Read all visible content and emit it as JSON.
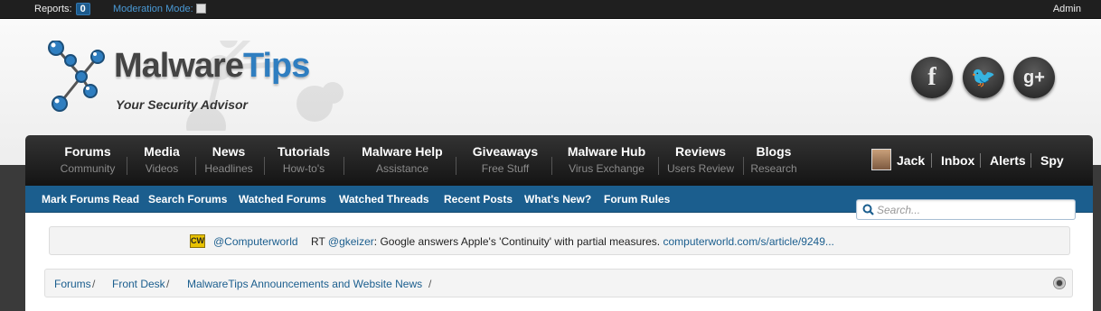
{
  "adminbar": {
    "reports_label": "Reports:",
    "reports_count": "0",
    "moderation_label": "Moderation Mode:",
    "admin_label": "Admin"
  },
  "logo": {
    "word_main": "Malware",
    "word_accent": "Tips",
    "tagline": "Your Security Advisor"
  },
  "social": {
    "facebook": "f",
    "twitter": "🐦",
    "googleplus": "g+"
  },
  "nav": {
    "tabs": [
      {
        "title": "Forums",
        "sub": "Community"
      },
      {
        "title": "Media",
        "sub": "Videos"
      },
      {
        "title": "News",
        "sub": "Headlines"
      },
      {
        "title": "Tutorials",
        "sub": "How-to's"
      },
      {
        "title": "Malware Help",
        "sub": "Assistance"
      },
      {
        "title": "Giveaways",
        "sub": "Free Stuff"
      },
      {
        "title": "Malware Hub",
        "sub": "Virus Exchange"
      },
      {
        "title": "Reviews",
        "sub": "Users Review"
      },
      {
        "title": "Blogs",
        "sub": "Research"
      }
    ],
    "user": "Jack",
    "inbox": "Inbox",
    "alerts": "Alerts",
    "spy": "Spy"
  },
  "subnav": {
    "items": [
      "Mark Forums Read",
      "Search Forums",
      "Watched Forums",
      "Watched Threads",
      "Recent Posts",
      "What's New?",
      "Forum Rules"
    ]
  },
  "search": {
    "placeholder": "Search..."
  },
  "ticker": {
    "badge": "CW",
    "handle": "@Computerworld",
    "rt": "RT ",
    "mention": "@gkeizer",
    "text": ": Google answers Apple's 'Continuity' with partial measures. ",
    "link": "computerworld.com/s/article/9249..."
  },
  "breadcrumb": {
    "items": [
      "Forums",
      "Front Desk",
      "MalwareTips Announcements and Website News"
    ],
    "separator": "/"
  },
  "colors": {
    "accent": "#1b5e8e",
    "logo_accent": "#2f7ec0"
  }
}
